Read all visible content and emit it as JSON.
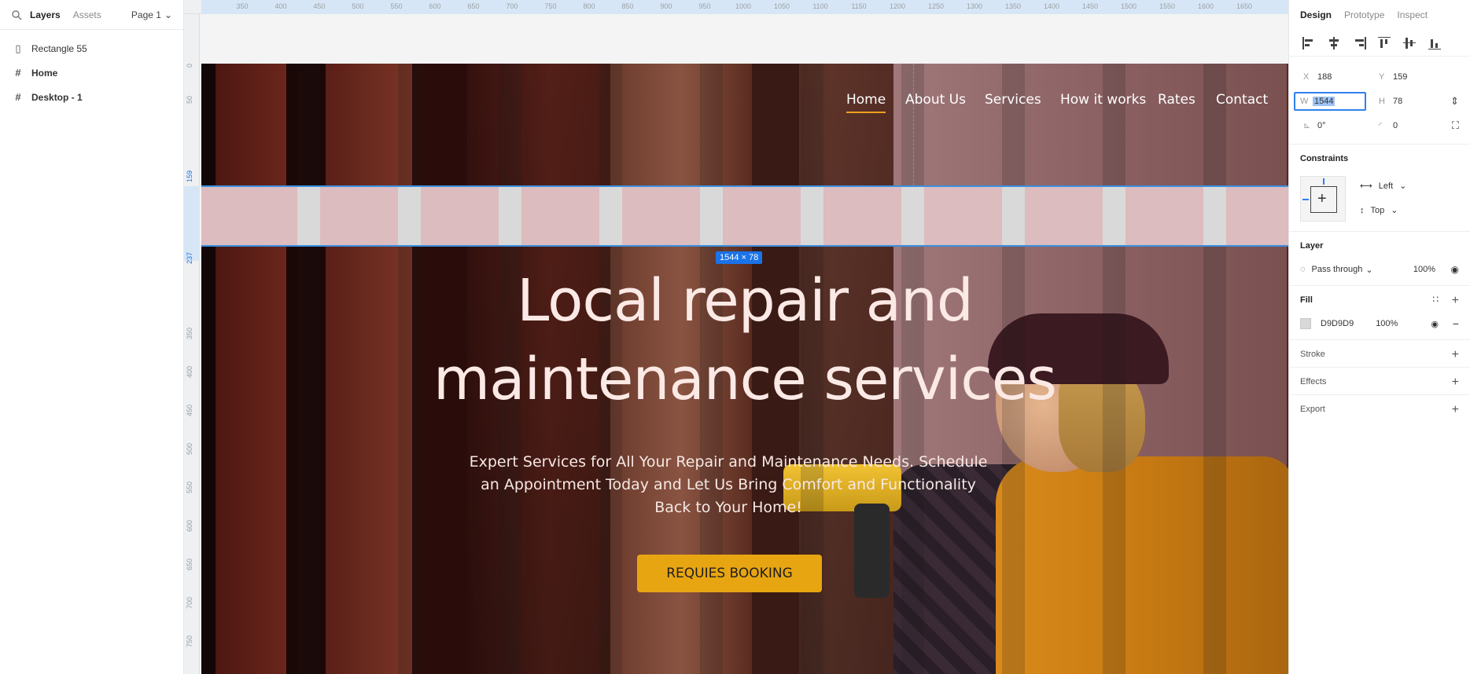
{
  "left_panel": {
    "tabs": [
      "Layers",
      "Assets"
    ],
    "page": "Page 1",
    "layers": [
      "Rectangle 55",
      "Home",
      "Desktop - 1"
    ]
  },
  "ruler": {
    "top_ticks": [
      "350",
      "400",
      "450",
      "500",
      "550",
      "600",
      "650",
      "700",
      "750",
      "800",
      "850",
      "900",
      "950",
      "1000",
      "1050",
      "1100",
      "1150",
      "1200",
      "1250",
      "1300",
      "1350",
      "1400",
      "1450",
      "1500",
      "1550",
      "1600",
      "1650"
    ],
    "left_ticks": [
      "0",
      "50",
      "159",
      "237",
      "350",
      "400",
      "450",
      "500",
      "550",
      "600",
      "650",
      "700",
      "750"
    ]
  },
  "site": {
    "nav": [
      "Home",
      "About Us",
      "Services",
      "How it works",
      "Rates",
      "Contact"
    ],
    "title_line1": "Local repair and",
    "title_line2": "maintenance services",
    "subtitle": "Expert Services for All Your Repair and Maintenance Needs. Schedule an Appointment Today and Let Us Bring Comfort and Functionality Back to Your Home!",
    "cta": "REQUIES BOOKING"
  },
  "selection": {
    "badge": "1544 × 78"
  },
  "right_panel": {
    "tabs": [
      "Design",
      "Prototype",
      "Inspect"
    ],
    "x_label": "X",
    "x_value": "188",
    "y_label": "Y",
    "y_value": "159",
    "w_label": "W",
    "w_value": "1544",
    "h_label": "H",
    "h_value": "78",
    "rotation": "0°",
    "radius": "0",
    "constraints_title": "Constraints",
    "constraint_h": "Left",
    "constraint_v": "Top",
    "layer_title": "Layer",
    "blend": "Pass through",
    "opacity": "100%",
    "fill_title": "Fill",
    "fill_hex": "D9D9D9",
    "fill_opacity": "100%",
    "stroke_title": "Stroke",
    "effects_title": "Effects",
    "export_title": "Export"
  }
}
